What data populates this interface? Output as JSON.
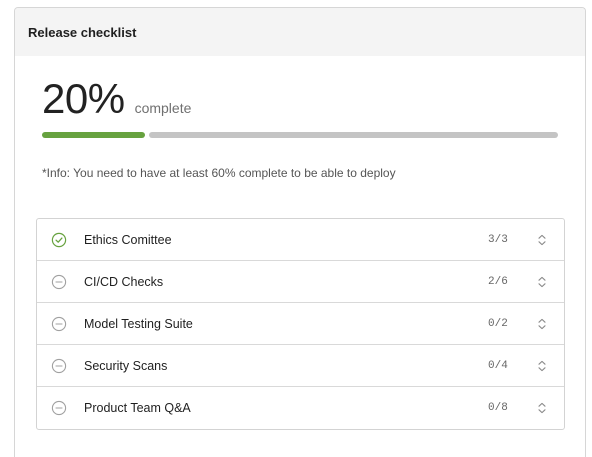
{
  "card": {
    "title": "Release checklist"
  },
  "progress": {
    "value_text": "20%",
    "label": "complete",
    "fraction": 0.2
  },
  "info_note": "*Info: You need to have at least 60% complete to be able to deploy",
  "colors": {
    "accent_green": "#67a23f",
    "track_gray": "#c4c4c4",
    "icon_gray": "#9a9a9a"
  },
  "checklist": [
    {
      "label": "Ethics Comittee",
      "count": "3/3",
      "status": "complete",
      "icon": "check-circle-icon"
    },
    {
      "label": "CI/CD Checks",
      "count": "2/6",
      "status": "incomplete",
      "icon": "minus-circle-icon"
    },
    {
      "label": "Model Testing Suite",
      "count": "0/2",
      "status": "incomplete",
      "icon": "minus-circle-icon"
    },
    {
      "label": "Security Scans",
      "count": "0/4",
      "status": "incomplete",
      "icon": "minus-circle-icon"
    },
    {
      "label": "Product Team Q&A",
      "count": "0/8",
      "status": "incomplete",
      "icon": "minus-circle-icon"
    }
  ]
}
